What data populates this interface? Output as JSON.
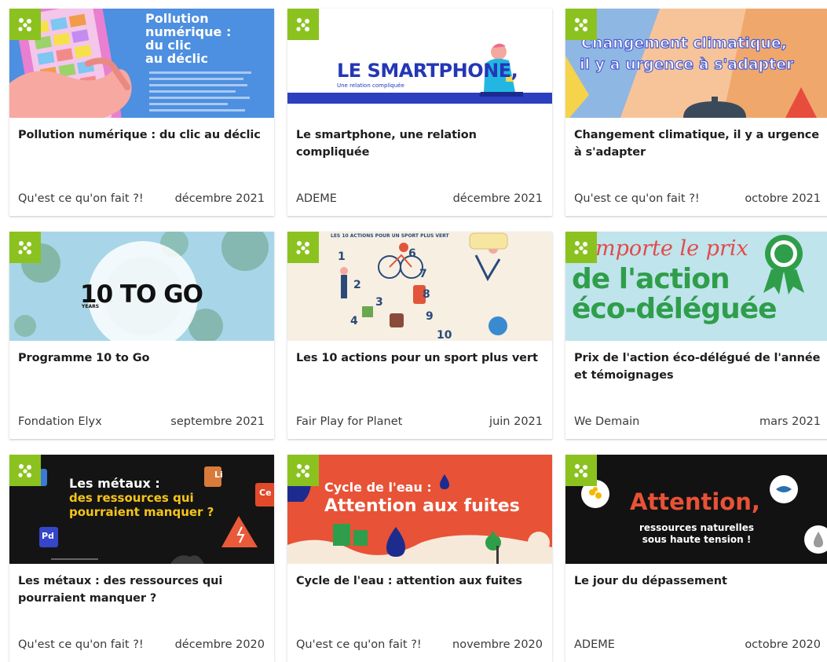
{
  "badge_color": "#8bc220",
  "badge_icon": "leaf-cluster-icon",
  "cards": [
    {
      "title": "Pollution numérique : du clic au déclic",
      "source": "Qu'est ce qu'on fait ?!",
      "date": "décembre 2021",
      "thumb_text": [
        "Pollution",
        "numérique :",
        "du clic",
        "au déclic"
      ]
    },
    {
      "title": "Le smartphone, une relation compliquée",
      "source": "ADEME",
      "date": "décembre 2021",
      "thumb_text": [
        "LE SMARTPHONE,",
        "Une relation compliquée"
      ]
    },
    {
      "title": "Changement climatique, il y a urgence à s'adapter",
      "source": "Qu'est ce qu'on fait ?!",
      "date": "octobre 2021",
      "thumb_text": [
        "Changement climatique,",
        "il y a urgence à s'adapter"
      ]
    },
    {
      "title": "Programme 10 to Go",
      "source": "Fondation Elyx",
      "date": "septembre 2021",
      "thumb_text": [
        "10 TO GO",
        "YEARS"
      ]
    },
    {
      "title": "Les 10 actions pour un sport plus vert",
      "source": "Fair Play for Planet",
      "date": "juin 2021",
      "thumb_text": [
        "LES 10 ACTIONS POUR UN SPORT PLUS VERT"
      ]
    },
    {
      "title": "Prix de l'action éco-délégué de l'année et témoignages",
      "source": "We Demain",
      "date": "mars 2021",
      "thumb_text": [
        "mporte le prix",
        "de l'action",
        "éco-déléguée"
      ]
    },
    {
      "title": "Les métaux : des ressources qui pourraient manquer ?",
      "source": "Qu'est ce qu'on fait ?!",
      "date": "décembre 2020",
      "thumb_text": [
        "Les métaux :",
        "des ressources qui",
        "pourraient manquer ?",
        "Li",
        "Ce",
        "Pd"
      ]
    },
    {
      "title": "Cycle de l'eau : attention aux fuites",
      "source": "Qu'est ce qu'on fait ?!",
      "date": "novembre 2020",
      "thumb_text": [
        "Cycle de l'eau :",
        "Attention aux fuites"
      ]
    },
    {
      "title": "Le jour du dépassement",
      "source": "ADEME",
      "date": "octobre 2020",
      "thumb_text": [
        "Attention,",
        "ressources naturelles",
        "sous haute tension !"
      ]
    }
  ]
}
